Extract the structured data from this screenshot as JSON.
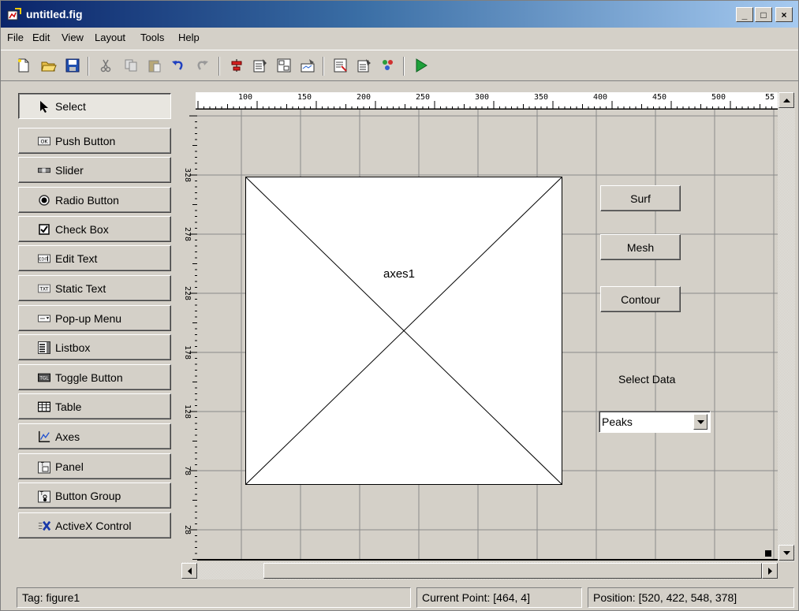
{
  "window": {
    "title": "untitled.fig"
  },
  "title_buttons": {
    "minimize": "_",
    "maximize": "□",
    "close": "×"
  },
  "menu": [
    "File",
    "Edit",
    "View",
    "Layout",
    "Tools",
    "Help"
  ],
  "toolbar": [
    "new-icon",
    "open-icon",
    "save-icon",
    "cut-icon",
    "copy-icon",
    "paste-icon",
    "undo-icon",
    "redo-icon",
    "align-icon",
    "menu-editor-icon",
    "tab-order-icon",
    "toolbar-editor-icon",
    "mfile-editor-icon",
    "property-inspector-icon",
    "object-browser-icon",
    "run-icon"
  ],
  "palette": [
    {
      "label": "Select",
      "icon": "pointer-icon"
    },
    {
      "label": "Push Button",
      "icon": "pushbutton-icon"
    },
    {
      "label": "Slider",
      "icon": "slider-icon"
    },
    {
      "label": "Radio Button",
      "icon": "radio-icon"
    },
    {
      "label": "Check Box",
      "icon": "checkbox-icon"
    },
    {
      "label": "Edit Text",
      "icon": "edittext-icon"
    },
    {
      "label": "Static Text",
      "icon": "statictext-icon"
    },
    {
      "label": "Pop-up Menu",
      "icon": "popup-icon"
    },
    {
      "label": "Listbox",
      "icon": "listbox-icon"
    },
    {
      "label": "Toggle Button",
      "icon": "toggle-icon"
    },
    {
      "label": "Table",
      "icon": "table-icon"
    },
    {
      "label": "Axes",
      "icon": "axes-icon"
    },
    {
      "label": "Panel",
      "icon": "panel-icon"
    },
    {
      "label": "Button Group",
      "icon": "buttongroup-icon"
    },
    {
      "label": "ActiveX Control",
      "icon": "activex-icon"
    }
  ],
  "rulers": {
    "top": [
      "100",
      "150",
      "200",
      "250",
      "300",
      "350",
      "400",
      "450",
      "500",
      "55"
    ],
    "left": [
      "328",
      "278",
      "228",
      "178",
      "128",
      "78",
      "28"
    ]
  },
  "canvas": {
    "axes_label": "axes1",
    "buttons": [
      "Surf",
      "Mesh",
      "Contour"
    ],
    "static_text": "Select Data",
    "popup_value": "Peaks"
  },
  "status": {
    "tag": "Tag: figure1",
    "current_point": "Current Point:  [464, 4]",
    "position": "Position: [520, 422, 548, 378]"
  }
}
